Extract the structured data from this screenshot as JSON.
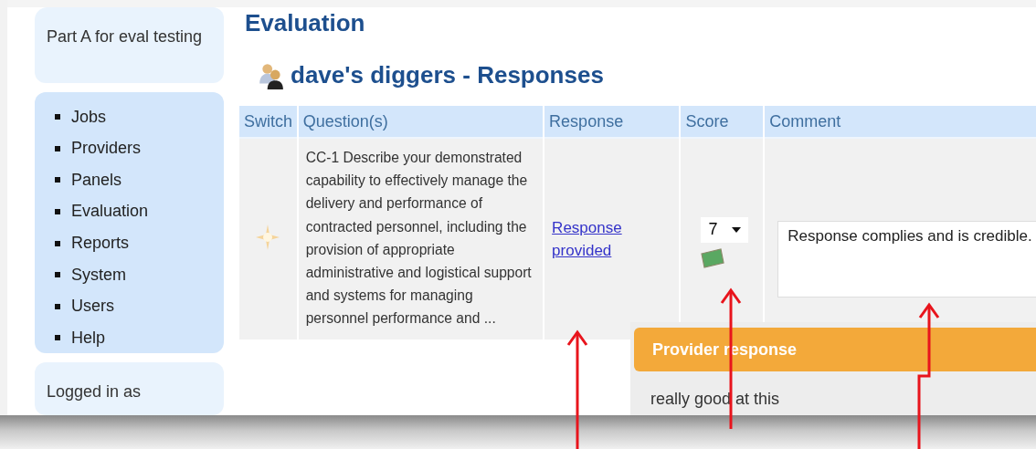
{
  "sidebar": {
    "title": "Part A for eval testing",
    "nav": [
      {
        "label": "Jobs"
      },
      {
        "label": "Providers"
      },
      {
        "label": "Panels"
      },
      {
        "label": "Evaluation"
      },
      {
        "label": "Reports"
      },
      {
        "label": "System"
      },
      {
        "label": "Users"
      },
      {
        "label": "Help"
      }
    ],
    "login": "Logged in as"
  },
  "page_title": "Evaluation",
  "section_title": "dave's diggers - Responses",
  "table": {
    "columns": [
      "Switch",
      "Question(s)",
      "Response",
      "Score",
      "Comment"
    ],
    "rows": [
      {
        "question": "CC-1 Describe your demonstrated capability to effectively manage the delivery and performance of contracted personnel, including the provision of appropriate administrative and logistical support and systems for managing personnel performance and ...",
        "response_link": "Response provided",
        "score": "7",
        "comment": "Response complies and is credible."
      }
    ]
  },
  "popup": {
    "title": "Provider response",
    "body": "really good at this"
  }
}
